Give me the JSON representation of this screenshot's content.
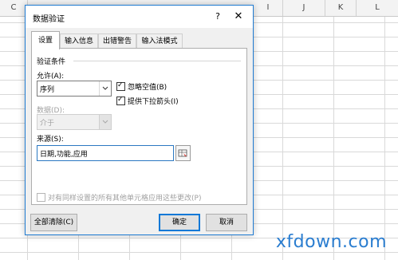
{
  "sheet": {
    "columns": [
      "C",
      "I",
      "J",
      "K",
      "L"
    ]
  },
  "watermark": "xfdown.com",
  "dialog": {
    "title": "数据验证",
    "help": "?",
    "close": "✕",
    "tabs": [
      "设置",
      "输入信息",
      "出错警告",
      "输入法模式"
    ],
    "active_tab": "设置",
    "section_title": "验证条件",
    "allow_label": "允许(A):",
    "allow_value": "序列",
    "ignore_blank_label": "忽略空值(B)",
    "ignore_blank_checked": true,
    "dropdown_label": "提供下拉箭头(I)",
    "dropdown_checked": true,
    "data_label": "数据(D):",
    "data_value": "介于",
    "source_label": "来源(S):",
    "source_value": "日期,功能,应用",
    "apply_all_label": "对有同样设置的所有其他单元格应用这些更改(P)",
    "apply_all_checked": false,
    "clear_all": "全部清除(C)",
    "ok": "确定",
    "cancel": "取消"
  }
}
